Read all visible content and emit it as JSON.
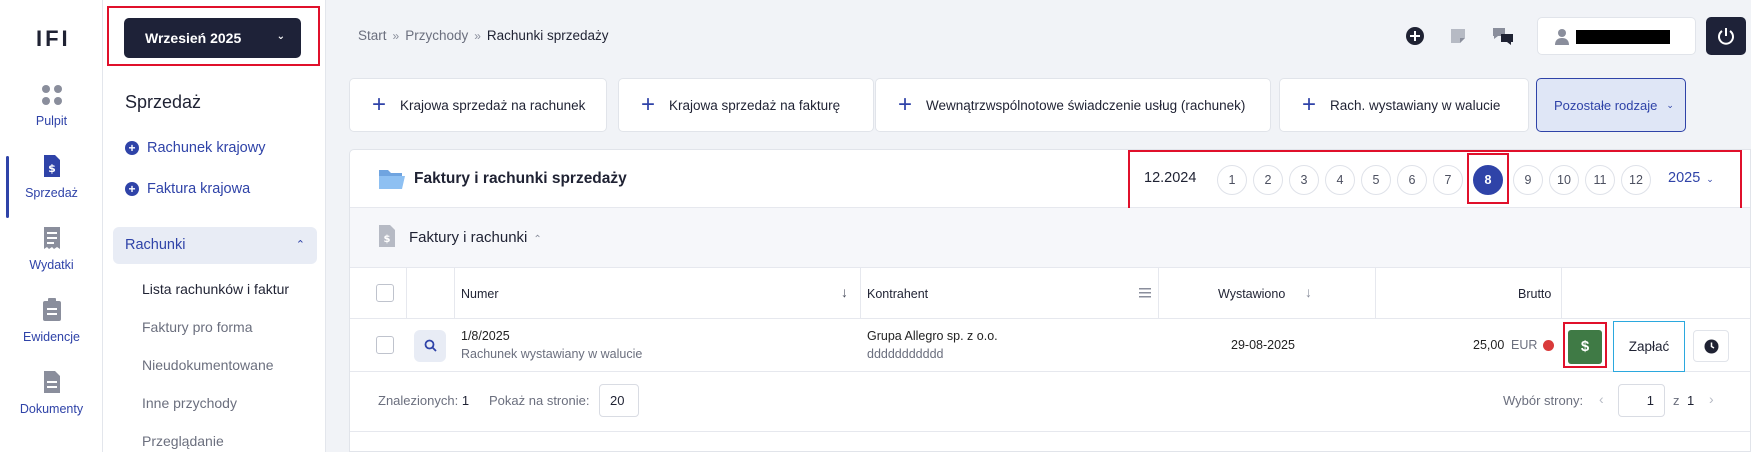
{
  "logo": "IFI",
  "rail": [
    {
      "label": "Pulpit",
      "icon": "grid-dots-icon"
    },
    {
      "label": "Sprzedaż",
      "icon": "invoice-dollar-icon"
    },
    {
      "label": "Wydatki",
      "icon": "receipt-icon"
    },
    {
      "label": "Ewidencje",
      "icon": "clipboard-icon"
    },
    {
      "label": "Dokumenty",
      "icon": "document-icon"
    }
  ],
  "sidebar": {
    "month_button": "Wrzesień 2025",
    "section_title": "Sprzedaż",
    "links": [
      "Rachunek krajowy",
      "Faktura krajowa"
    ],
    "accordion": "Rachunki",
    "items": [
      "Lista rachunków i faktur",
      "Faktury pro forma",
      "Nieudokumentowane",
      "Inne przychody",
      "Przeglądanie"
    ]
  },
  "breadcrumb": [
    "Start",
    "Przychody",
    "Rachunki sprzedaży"
  ],
  "actions": [
    "Krajowa sprzedaż na rachunek",
    "Krajowa sprzedaż na fakturę",
    "Wewnątrzwspólnotowe świadczenie usług (rachunek)",
    "Rach. wystawiany w walucie"
  ],
  "other_types": "Pozostałe rodzaje",
  "card": {
    "title": "Faktury i rachunki sprzedaży",
    "period_label": "12.2024",
    "months": [
      "1",
      "2",
      "3",
      "4",
      "5",
      "6",
      "7",
      "8",
      "9",
      "10",
      "11",
      "12"
    ],
    "active_month": "8",
    "year": "2025",
    "subsection": "Faktury i rachunki"
  },
  "table": {
    "headers": {
      "number": "Numer",
      "contractor": "Kontrahent",
      "issued": "Wystawiono",
      "gross": "Brutto"
    },
    "rows": [
      {
        "number": "1/8/2025",
        "type": "Rachunek wystawiany w walucie",
        "contractor": "Grupa Allegro sp. z o.o.",
        "contractor_note": "ddddddddddd",
        "issued": "29-08-2025",
        "gross": "25,00",
        "currency": "EUR",
        "pay_icon": "$",
        "pay_label": "Zapłać"
      }
    ]
  },
  "footer": {
    "found_label": "Znalezionych:",
    "found_count": "1",
    "per_page_label": "Pokaż na stronie:",
    "per_page": "20",
    "page_label": "Wybór strony:",
    "page": "1",
    "of_label": "z",
    "total_pages": "1"
  },
  "colors": {
    "accent": "#2f43a8",
    "dark": "#1e2238",
    "highlight": "#e0102b",
    "pay": "#3f7a45"
  }
}
